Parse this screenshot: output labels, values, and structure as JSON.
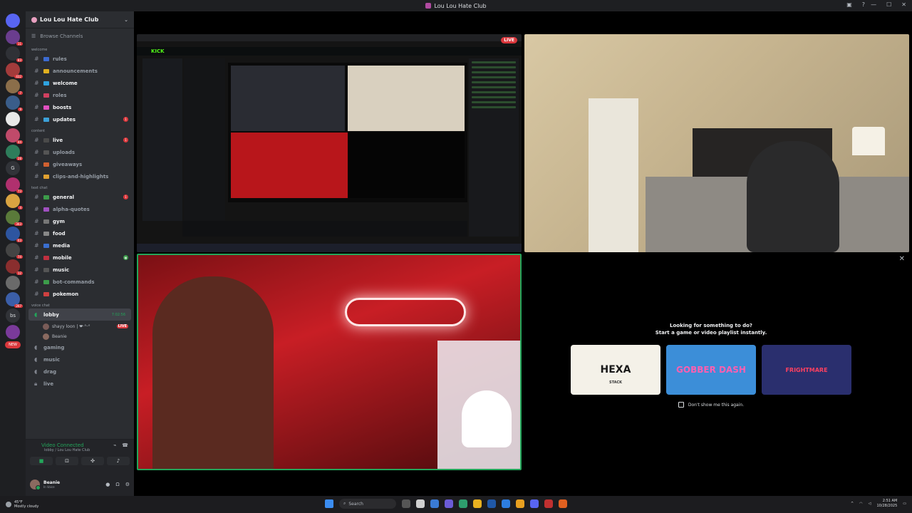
{
  "window": {
    "title": "Lou Lou Hate Club"
  },
  "server_rail": {
    "badges": [
      "11",
      "83",
      "432",
      "7",
      "9",
      "44",
      "28",
      "73",
      "4",
      "363",
      "63",
      "74",
      "12",
      "267",
      "G",
      "bs"
    ],
    "new_label": "NEW"
  },
  "server": {
    "name": "Lou Lou Hate Club",
    "browse_label": "Browse Channels"
  },
  "categories": {
    "welcome": "welcome",
    "content": "content",
    "text_chat": "text chat",
    "voice_chat": "voice chat"
  },
  "channels": {
    "rules": "rules",
    "announcements": "announcements",
    "welcome": "welcome",
    "roles": "roles",
    "boosts": "boosts",
    "updates": "updates",
    "updates_badge": "1",
    "live": "live",
    "live_badge": "1",
    "uploads": "uploads",
    "giveaways": "giveaways",
    "clips": "clips-and-highlights",
    "general": "general",
    "general_badge": "1",
    "alpha_quotes": "alpha-quotes",
    "gym": "gym",
    "food": "food",
    "media": "media",
    "mobile": "mobile",
    "music": "music",
    "bot_commands": "bot-commands",
    "pokemon": "pokemon",
    "lobby": "lobby",
    "lobby_timer": "7:02:56",
    "lobby_status": "Set a channel status",
    "gaming": "gaming",
    "music_vc": "music",
    "drag": "drag",
    "live_vc": "live"
  },
  "voice_users": {
    "streamer": "shayy loon | ❤·°ᵕ°",
    "streamer_live": "LIVE",
    "beanie": "Beanie"
  },
  "voice_panel": {
    "status": "Video Connected",
    "location": "lobby / Lou Lou Hate Club"
  },
  "user": {
    "name": "Beanie",
    "status": "In Voice"
  },
  "stream": {
    "live_label": "LIVE",
    "kick_logo": "KICK"
  },
  "activity": {
    "title_line1": "Looking for something to do?",
    "title_line2": "Start a game or video playlist instantly.",
    "cards": [
      {
        "name": "HEXA",
        "sub": "STACK"
      },
      {
        "name": "GOBBER DASH",
        "sub": ""
      },
      {
        "name": "FRIGHTMARE",
        "sub": ""
      }
    ],
    "dont_show": "Don't show me this again."
  },
  "taskbar": {
    "weather_temp": "45°F",
    "weather_desc": "Mostly cloudy",
    "search_label": "Search",
    "time": "2:51 AM",
    "date": "10/28/2025"
  }
}
